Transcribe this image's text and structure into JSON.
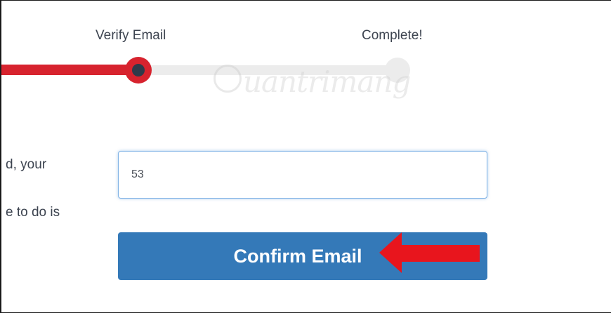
{
  "steps": {
    "verify_label": "Verify Email",
    "complete_label": "Complete!"
  },
  "instructions": {
    "line1": "d, your",
    "line2": "e to do is"
  },
  "code_input": {
    "value": "53"
  },
  "confirm_button": {
    "label": "Confirm Email"
  },
  "watermark": {
    "text": "uantrimang"
  },
  "colors": {
    "progress_done": "#d7232e",
    "progress_pending": "#ececec",
    "button": "#3479b8",
    "arrow": "#e8151d"
  }
}
